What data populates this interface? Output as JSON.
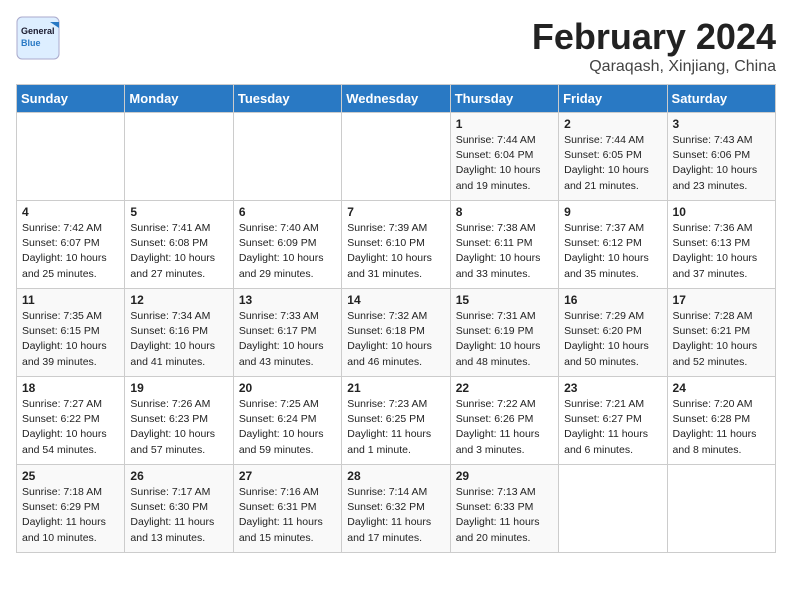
{
  "header": {
    "logo_line1": "General",
    "logo_line2": "Blue",
    "month_year": "February 2024",
    "location": "Qaraqash, Xinjiang, China"
  },
  "days_of_week": [
    "Sunday",
    "Monday",
    "Tuesday",
    "Wednesday",
    "Thursday",
    "Friday",
    "Saturday"
  ],
  "weeks": [
    [
      {
        "day": "",
        "info": ""
      },
      {
        "day": "",
        "info": ""
      },
      {
        "day": "",
        "info": ""
      },
      {
        "day": "",
        "info": ""
      },
      {
        "day": "1",
        "info": "Sunrise: 7:44 AM\nSunset: 6:04 PM\nDaylight: 10 hours\nand 19 minutes."
      },
      {
        "day": "2",
        "info": "Sunrise: 7:44 AM\nSunset: 6:05 PM\nDaylight: 10 hours\nand 21 minutes."
      },
      {
        "day": "3",
        "info": "Sunrise: 7:43 AM\nSunset: 6:06 PM\nDaylight: 10 hours\nand 23 minutes."
      }
    ],
    [
      {
        "day": "4",
        "info": "Sunrise: 7:42 AM\nSunset: 6:07 PM\nDaylight: 10 hours\nand 25 minutes."
      },
      {
        "day": "5",
        "info": "Sunrise: 7:41 AM\nSunset: 6:08 PM\nDaylight: 10 hours\nand 27 minutes."
      },
      {
        "day": "6",
        "info": "Sunrise: 7:40 AM\nSunset: 6:09 PM\nDaylight: 10 hours\nand 29 minutes."
      },
      {
        "day": "7",
        "info": "Sunrise: 7:39 AM\nSunset: 6:10 PM\nDaylight: 10 hours\nand 31 minutes."
      },
      {
        "day": "8",
        "info": "Sunrise: 7:38 AM\nSunset: 6:11 PM\nDaylight: 10 hours\nand 33 minutes."
      },
      {
        "day": "9",
        "info": "Sunrise: 7:37 AM\nSunset: 6:12 PM\nDaylight: 10 hours\nand 35 minutes."
      },
      {
        "day": "10",
        "info": "Sunrise: 7:36 AM\nSunset: 6:13 PM\nDaylight: 10 hours\nand 37 minutes."
      }
    ],
    [
      {
        "day": "11",
        "info": "Sunrise: 7:35 AM\nSunset: 6:15 PM\nDaylight: 10 hours\nand 39 minutes."
      },
      {
        "day": "12",
        "info": "Sunrise: 7:34 AM\nSunset: 6:16 PM\nDaylight: 10 hours\nand 41 minutes."
      },
      {
        "day": "13",
        "info": "Sunrise: 7:33 AM\nSunset: 6:17 PM\nDaylight: 10 hours\nand 43 minutes."
      },
      {
        "day": "14",
        "info": "Sunrise: 7:32 AM\nSunset: 6:18 PM\nDaylight: 10 hours\nand 46 minutes."
      },
      {
        "day": "15",
        "info": "Sunrise: 7:31 AM\nSunset: 6:19 PM\nDaylight: 10 hours\nand 48 minutes."
      },
      {
        "day": "16",
        "info": "Sunrise: 7:29 AM\nSunset: 6:20 PM\nDaylight: 10 hours\nand 50 minutes."
      },
      {
        "day": "17",
        "info": "Sunrise: 7:28 AM\nSunset: 6:21 PM\nDaylight: 10 hours\nand 52 minutes."
      }
    ],
    [
      {
        "day": "18",
        "info": "Sunrise: 7:27 AM\nSunset: 6:22 PM\nDaylight: 10 hours\nand 54 minutes."
      },
      {
        "day": "19",
        "info": "Sunrise: 7:26 AM\nSunset: 6:23 PM\nDaylight: 10 hours\nand 57 minutes."
      },
      {
        "day": "20",
        "info": "Sunrise: 7:25 AM\nSunset: 6:24 PM\nDaylight: 10 hours\nand 59 minutes."
      },
      {
        "day": "21",
        "info": "Sunrise: 7:23 AM\nSunset: 6:25 PM\nDaylight: 11 hours\nand 1 minute."
      },
      {
        "day": "22",
        "info": "Sunrise: 7:22 AM\nSunset: 6:26 PM\nDaylight: 11 hours\nand 3 minutes."
      },
      {
        "day": "23",
        "info": "Sunrise: 7:21 AM\nSunset: 6:27 PM\nDaylight: 11 hours\nand 6 minutes."
      },
      {
        "day": "24",
        "info": "Sunrise: 7:20 AM\nSunset: 6:28 PM\nDaylight: 11 hours\nand 8 minutes."
      }
    ],
    [
      {
        "day": "25",
        "info": "Sunrise: 7:18 AM\nSunset: 6:29 PM\nDaylight: 11 hours\nand 10 minutes."
      },
      {
        "day": "26",
        "info": "Sunrise: 7:17 AM\nSunset: 6:30 PM\nDaylight: 11 hours\nand 13 minutes."
      },
      {
        "day": "27",
        "info": "Sunrise: 7:16 AM\nSunset: 6:31 PM\nDaylight: 11 hours\nand 15 minutes."
      },
      {
        "day": "28",
        "info": "Sunrise: 7:14 AM\nSunset: 6:32 PM\nDaylight: 11 hours\nand 17 minutes."
      },
      {
        "day": "29",
        "info": "Sunrise: 7:13 AM\nSunset: 6:33 PM\nDaylight: 11 hours\nand 20 minutes."
      },
      {
        "day": "",
        "info": ""
      },
      {
        "day": "",
        "info": ""
      }
    ]
  ]
}
